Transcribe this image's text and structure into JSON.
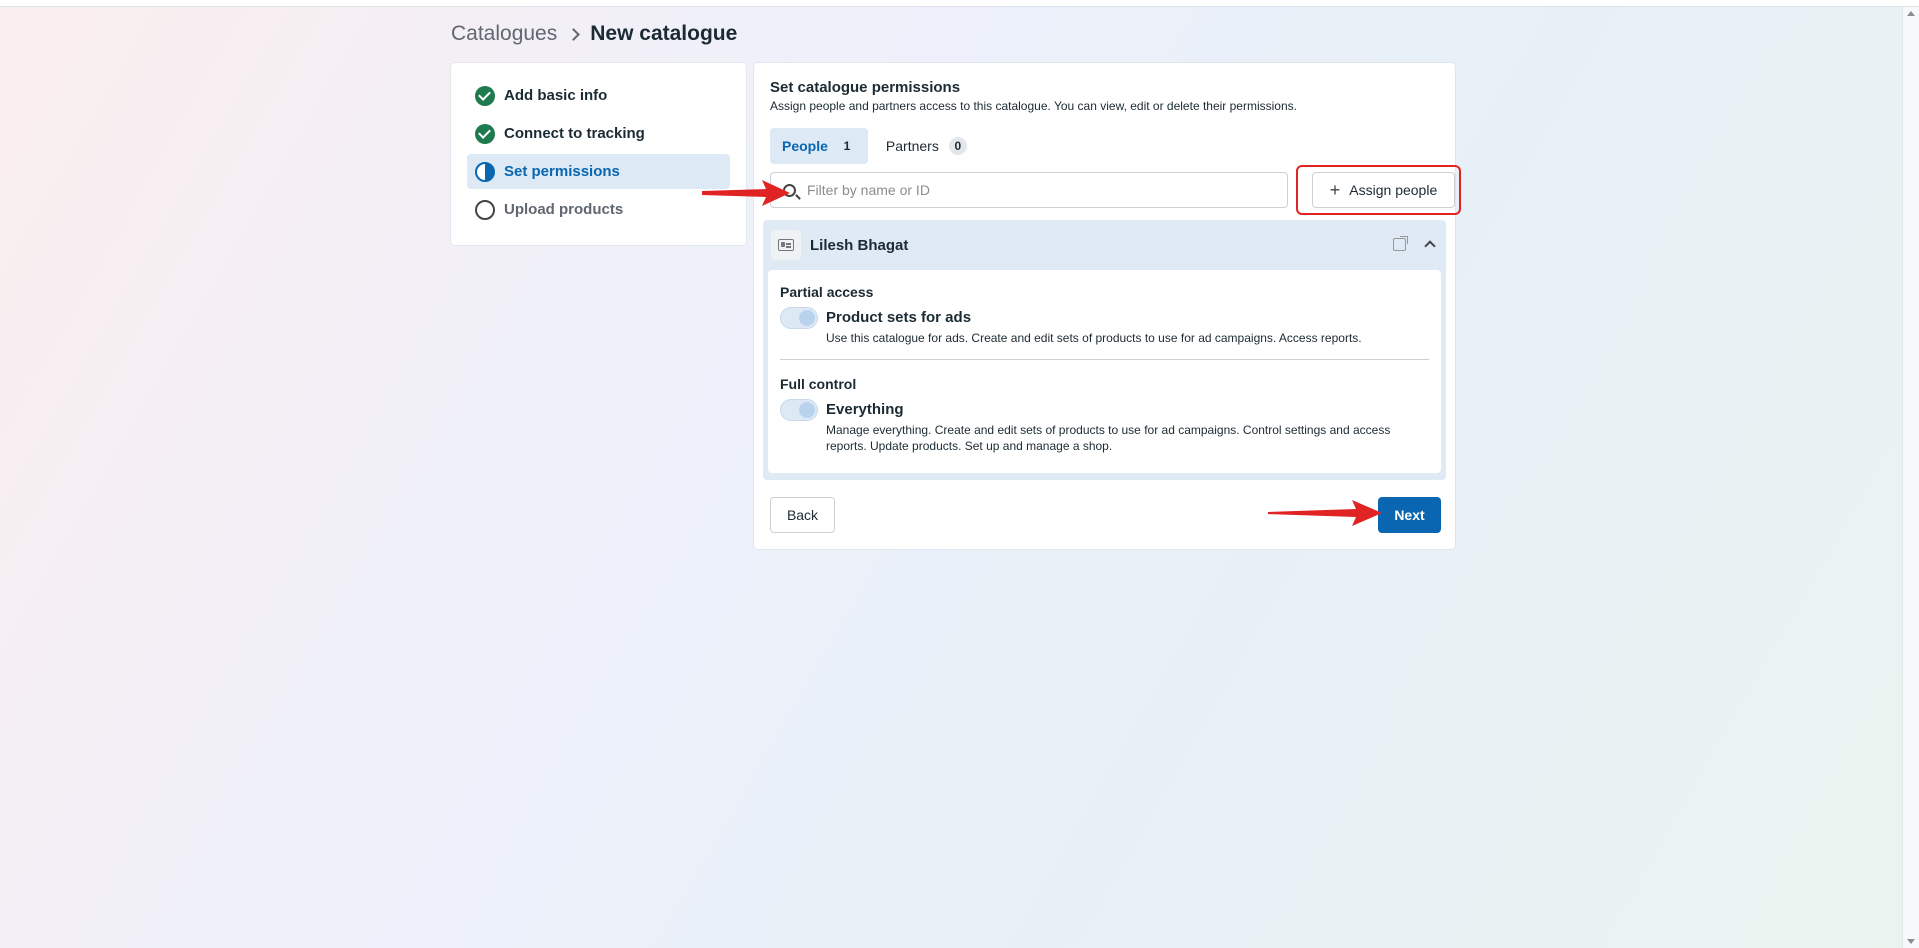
{
  "breadcrumb": {
    "parent": "Catalogues",
    "current": "New catalogue"
  },
  "steps": [
    {
      "label": "Add basic info",
      "state": "done"
    },
    {
      "label": "Connect to tracking",
      "state": "done"
    },
    {
      "label": "Set permissions",
      "state": "active"
    },
    {
      "label": "Upload products",
      "state": "todo"
    }
  ],
  "main": {
    "title": "Set catalogue permissions",
    "subtitle": "Assign people and partners access to this catalogue. You can view, edit or delete their permissions.",
    "tabs": [
      {
        "label": "People",
        "count": "1"
      },
      {
        "label": "Partners",
        "count": "0"
      }
    ],
    "search": {
      "placeholder": "Filter by name or ID",
      "value": ""
    },
    "assign_label": "Assign people",
    "person": {
      "name": "Lilesh Bhagat",
      "partial": {
        "heading": "Partial access",
        "title": "Product sets for ads",
        "desc": "Use this catalogue for ads. Create and edit sets of products to use for ad campaigns. Access reports."
      },
      "full": {
        "heading": "Full control",
        "title": "Everything",
        "desc": "Manage everything. Create and edit sets of products to use for ad campaigns. Control settings and access reports. Update products. Set up and manage a shop."
      }
    },
    "back_label": "Back",
    "next_label": "Next"
  },
  "colors": {
    "accent": "#0a66b0",
    "done": "#1f7a50",
    "annotation": "#e02424"
  }
}
